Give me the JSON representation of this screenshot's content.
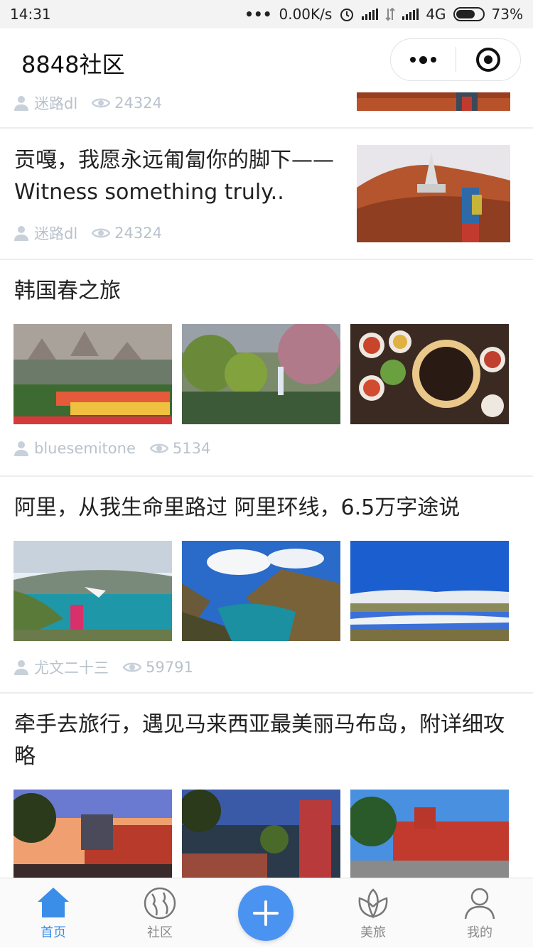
{
  "status": {
    "time": "14:31",
    "speed": "0.00K/s",
    "network": "4G",
    "battery": "73%",
    "battery_level": 0.73
  },
  "app": {
    "title": "8848社区"
  },
  "posts": [
    {
      "title": "",
      "author": "迷路dl",
      "views": "24324"
    },
    {
      "title": "贡嘎，我愿永远匍匐你的脚下——Witness something truly..",
      "author": "迷路dl",
      "views": "24324"
    },
    {
      "title": "韩国春之旅",
      "author": "bluesemitone",
      "views": "5134"
    },
    {
      "title": "阿里，从我生命里路过 阿里环线，6.5万字途说",
      "author": "尤文二十三",
      "views": "59791"
    },
    {
      "title": "牵手去旅行，遇见马来西亚最美丽马布岛，附详细攻略",
      "author": "",
      "views": ""
    }
  ],
  "tabbar": [
    {
      "label": "首页",
      "icon": "home-icon",
      "active": true
    },
    {
      "label": "社区",
      "icon": "globe-icon",
      "active": false
    },
    {
      "label": "",
      "icon": "plus-icon",
      "active": false
    },
    {
      "label": "美旅",
      "icon": "lotus-icon",
      "active": false
    },
    {
      "label": "我的",
      "icon": "person-icon",
      "active": false
    }
  ],
  "colors": {
    "accent": "#3a8ee8",
    "plus_button": "#4b93f0",
    "meta_text": "#b9c2cc"
  }
}
